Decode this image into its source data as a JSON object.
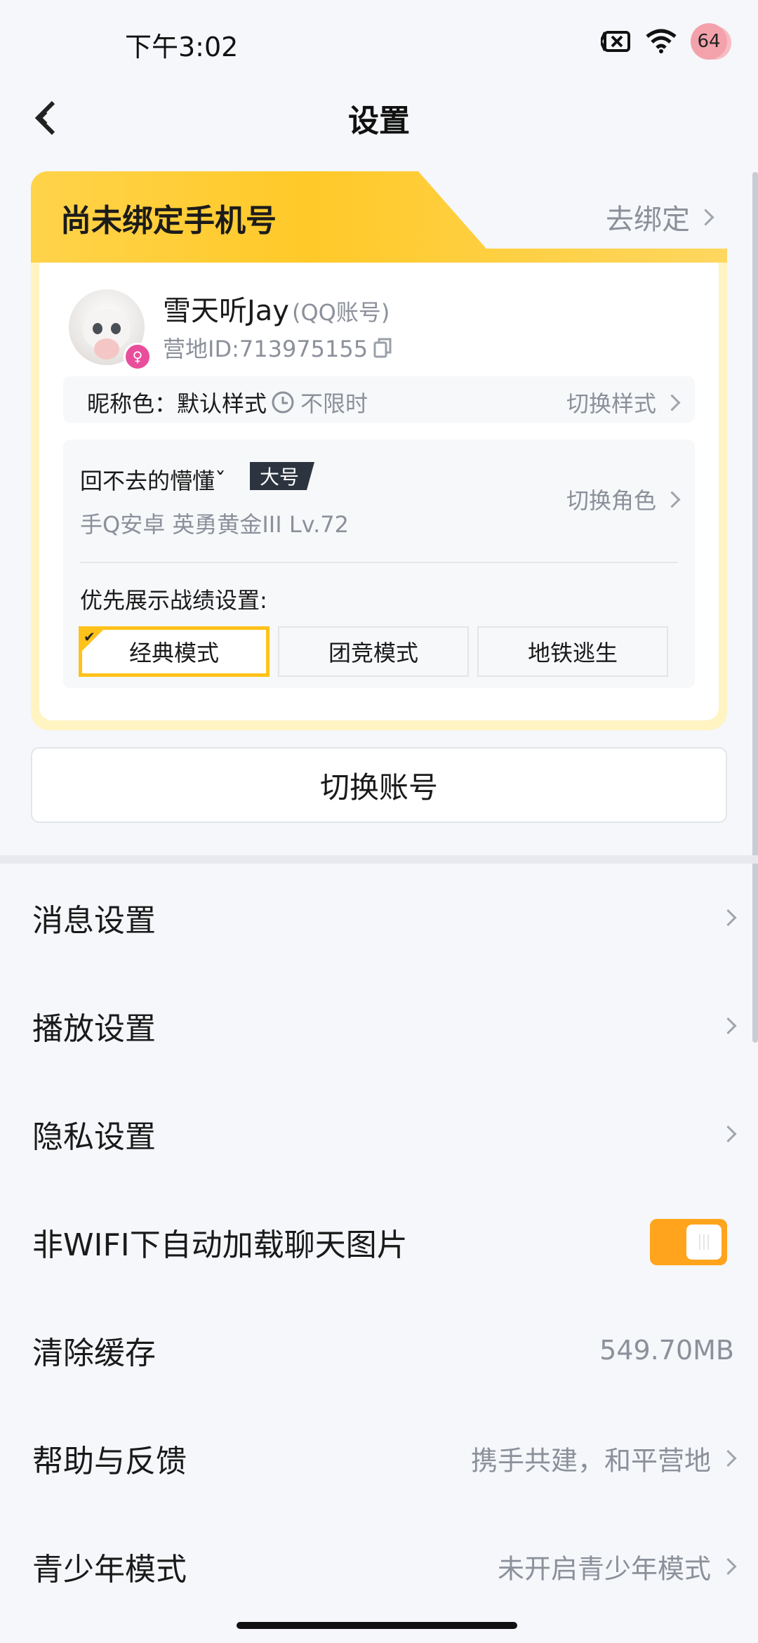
{
  "status_bar": {
    "time": "下午3:02",
    "battery": "64"
  },
  "header": {
    "title": "设置"
  },
  "account_card": {
    "banner_title": "尚未绑定手机号",
    "banner_action": "去绑定",
    "nickname": "雪天听Jay",
    "nickname_tag": "(QQ账号)",
    "camp_id": "营地ID:713975155",
    "nickname_color_label": "昵称色：默认样式",
    "nickname_color_limit": "不限时",
    "nickname_color_switch": "切换样式",
    "role_name": "回不去的懵懂ˇ",
    "role_badge": "大号",
    "role_info": "手Q安卓  英勇黄金III  Lv.72",
    "role_switch": "切换角色",
    "pref_label": "优先展示战绩设置:",
    "modes": [
      {
        "label": "经典模式",
        "selected": true
      },
      {
        "label": "团竞模式",
        "selected": false
      },
      {
        "label": "地铁逃生",
        "selected": false
      }
    ]
  },
  "switch_account_label": "切换账号",
  "settings_list": [
    {
      "label": "消息设置",
      "right": ""
    },
    {
      "label": "播放设置",
      "right": ""
    },
    {
      "label": "隐私设置",
      "right": ""
    },
    {
      "label": "非WIFI下自动加载聊天图片",
      "toggle_on": true
    },
    {
      "label": "清除缓存",
      "right": "549.70MB"
    },
    {
      "label": "帮助与反馈",
      "right": "携手共建，和平营地"
    },
    {
      "label": "青少年模式",
      "right": "未开启青少年模式"
    }
  ],
  "colors": {
    "accent": "#ffc21a",
    "toggle": "#ffa41c",
    "gender": "#e84e9b"
  },
  "icons": [
    "back-icon",
    "no-sim-icon",
    "wifi-icon",
    "battery-icon",
    "chevron-right-icon",
    "copy-icon",
    "clock-icon",
    "female-icon",
    "check-icon"
  ]
}
